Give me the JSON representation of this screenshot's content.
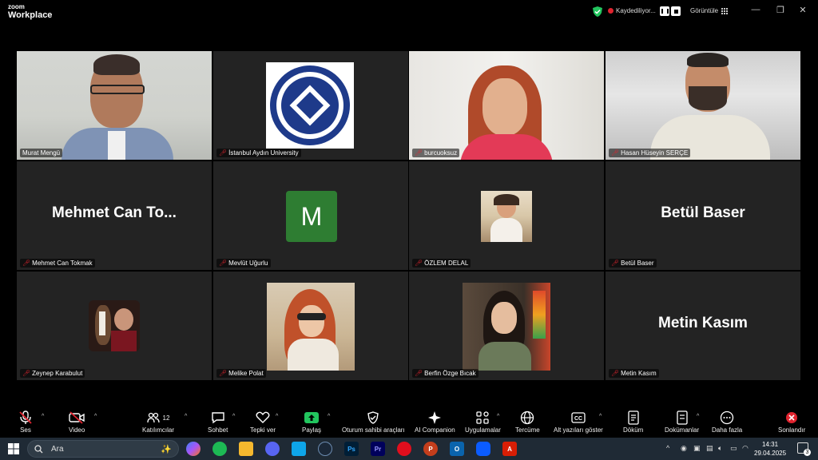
{
  "app": {
    "logo_top": "zoom",
    "logo_bottom": "Workplace"
  },
  "recording": {
    "label": "Kaydediliyor..."
  },
  "view": {
    "label": "Görüntüle"
  },
  "window": {
    "minimize": "—",
    "restore": "❐",
    "close": "✕"
  },
  "participants": [
    {
      "name": "Murat Mengü",
      "big": "",
      "muted": false,
      "active": true
    },
    {
      "name": "İstanbul Aydın University",
      "big": "",
      "muted": true,
      "active": false
    },
    {
      "name": "burcuoksuz",
      "big": "",
      "muted": true,
      "active": false
    },
    {
      "name": "Hasan Hüseyin SERÇE",
      "big": "",
      "muted": true,
      "active": false
    },
    {
      "name": "Mehmet Can Tokmak",
      "big": "Mehmet Can To...",
      "muted": true,
      "active": false
    },
    {
      "name": "Mevlüt Uğurlu",
      "big": "",
      "avatar_letter": "M",
      "avatar_color": "#2e7d32",
      "muted": true,
      "active": false
    },
    {
      "name": "ÖZLEM DELAL",
      "big": "",
      "muted": true,
      "active": false
    },
    {
      "name": "Betül Baser",
      "big": "Betül Baser",
      "muted": true,
      "active": false
    },
    {
      "name": "Zeynep Karabulut",
      "big": "",
      "muted": true,
      "active": false
    },
    {
      "name": "Melike Polat",
      "big": "",
      "muted": true,
      "active": false
    },
    {
      "name": "Berfin Özge Bıcak",
      "big": "",
      "muted": true,
      "active": false
    },
    {
      "name": "Metin Kasım",
      "big": "Metin Kasım",
      "muted": true,
      "active": false
    }
  ],
  "toolbar": {
    "audio": "Ses",
    "video": "Video",
    "participants": "Katılımcılar",
    "participants_count": "12",
    "chat": "Sohbet",
    "react": "Tepki ver",
    "share": "Paylaş",
    "host_tools": "Oturum sahibi araçları",
    "ai": "AI Companion",
    "apps": "Uygulamalar",
    "translate": "Tercüme",
    "captions": "Alt yazıları göster",
    "transcript": "Döküm",
    "docs": "Dokümanlar",
    "more": "Daha fazla",
    "end": "Sonlandır"
  },
  "taskbar": {
    "search_placeholder": "Ara",
    "time": "14:31",
    "date": "29.04.2025",
    "notif_count": "3"
  },
  "colors": {
    "accent_green": "#22c55e",
    "mute_red": "#e0242f",
    "share_green": "#22c55e"
  }
}
